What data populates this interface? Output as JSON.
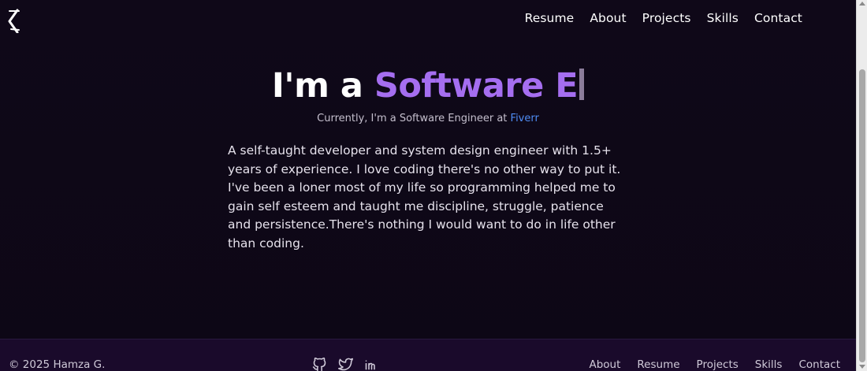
{
  "header": {
    "nav": [
      "Resume",
      "About",
      "Projects",
      "Skills",
      "Contact"
    ]
  },
  "hero": {
    "title_prefix": "I'm a ",
    "title_accent": "Software E",
    "subtitle_prefix": "Currently, I'm a Software Engineer at ",
    "company": "Fiverr",
    "bio": "A self-taught developer and system design engineer with 1.5+ years of experience. I love coding there's no other way to put it. I've been a loner most of my life so programming helped me to gain self esteem and taught me discipline, struggle, patience and persistence.There's nothing I would want to do in life other than coding."
  },
  "footer": {
    "copyright": "© 2025 Hamza G.",
    "socials": [
      "github-icon",
      "twitter-icon",
      "linkedin-icon"
    ],
    "nav": [
      "About",
      "Resume",
      "Projects",
      "Skills",
      "Contact"
    ]
  },
  "colors": {
    "background": "#0f0818",
    "accent": "#a56ef0",
    "link": "#4f8df5",
    "footer_bg": "#1a0a2b"
  }
}
